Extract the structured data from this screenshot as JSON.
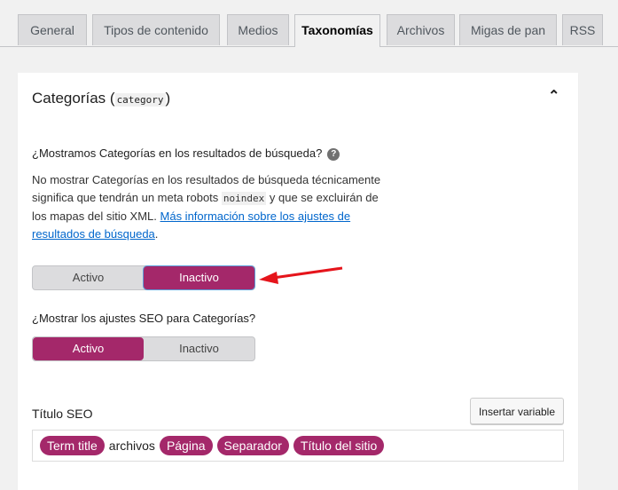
{
  "tabs": [
    "General",
    "Tipos de contenido",
    "Medios",
    "Taxonomías",
    "Archivos",
    "Migas de pan",
    "RSS"
  ],
  "active_tab": "Taxonomías",
  "section": {
    "title": "Categorías",
    "code": "category"
  },
  "q1": "¿Mostramos Categorías en los resultados de búsqueda?",
  "desc": {
    "p1": "No mostrar Categorías en los resultados de búsqueda técnicamente significa que tendrán un meta robots ",
    "code": "noindex",
    "p2": " y que se excluirán de los mapas del sitio XML. ",
    "link": "Más información sobre los ajustes de resultados de búsqueda",
    "p3": "."
  },
  "toggle1": {
    "on": "Activo",
    "off": "Inactivo",
    "selected": "Inactivo"
  },
  "q2": "¿Mostrar los ajustes SEO para Categorías?",
  "toggle2": {
    "on": "Activo",
    "off": "Inactivo",
    "selected": "Activo"
  },
  "seo_title": {
    "label": "Título SEO",
    "insert": "Insertar variable",
    "parts": [
      "Term title",
      "archivos",
      "Página",
      "Separador",
      "Título del sitio"
    ]
  },
  "colors": {
    "accent": "#a4286a",
    "arrow": "#e5141b"
  }
}
